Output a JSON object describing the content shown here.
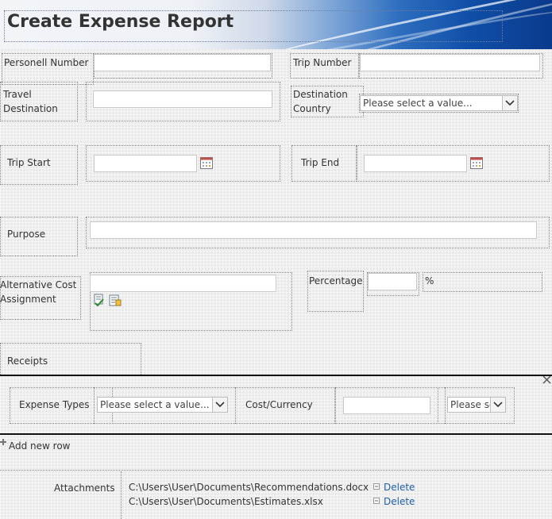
{
  "header": {
    "title": "Create Expense Report"
  },
  "form": {
    "personell_number_label": "Personell Number",
    "trip_number_label": "Trip Number",
    "travel_destination_label": "Travel Destination",
    "destination_country_label": "Destination Country",
    "destination_country_value": "Please select a value...",
    "trip_start_label": "Trip Start",
    "trip_end_label": "Trip End",
    "purpose_label": "Purpose",
    "alt_cost_label": "Alternative Cost Assignment",
    "percentage_label": "Percentage",
    "percent_sign": "%",
    "receipts_label": "Receipts"
  },
  "receipts": {
    "expense_types_label": "Expense Types",
    "expense_types_value": "Please select a value...",
    "cost_currency_label": "Cost/Currency",
    "currency_value": "Please se",
    "add_row_label": "Add new row"
  },
  "attachments": {
    "label": "Attachments",
    "items": [
      {
        "path": "C:\\Users\\User\\Documents\\Recommendations.docx",
        "delete_label": "Delete"
      },
      {
        "path": "C:\\Users\\User\\Documents\\Estimates.xlsx",
        "delete_label": "Delete"
      }
    ]
  }
}
